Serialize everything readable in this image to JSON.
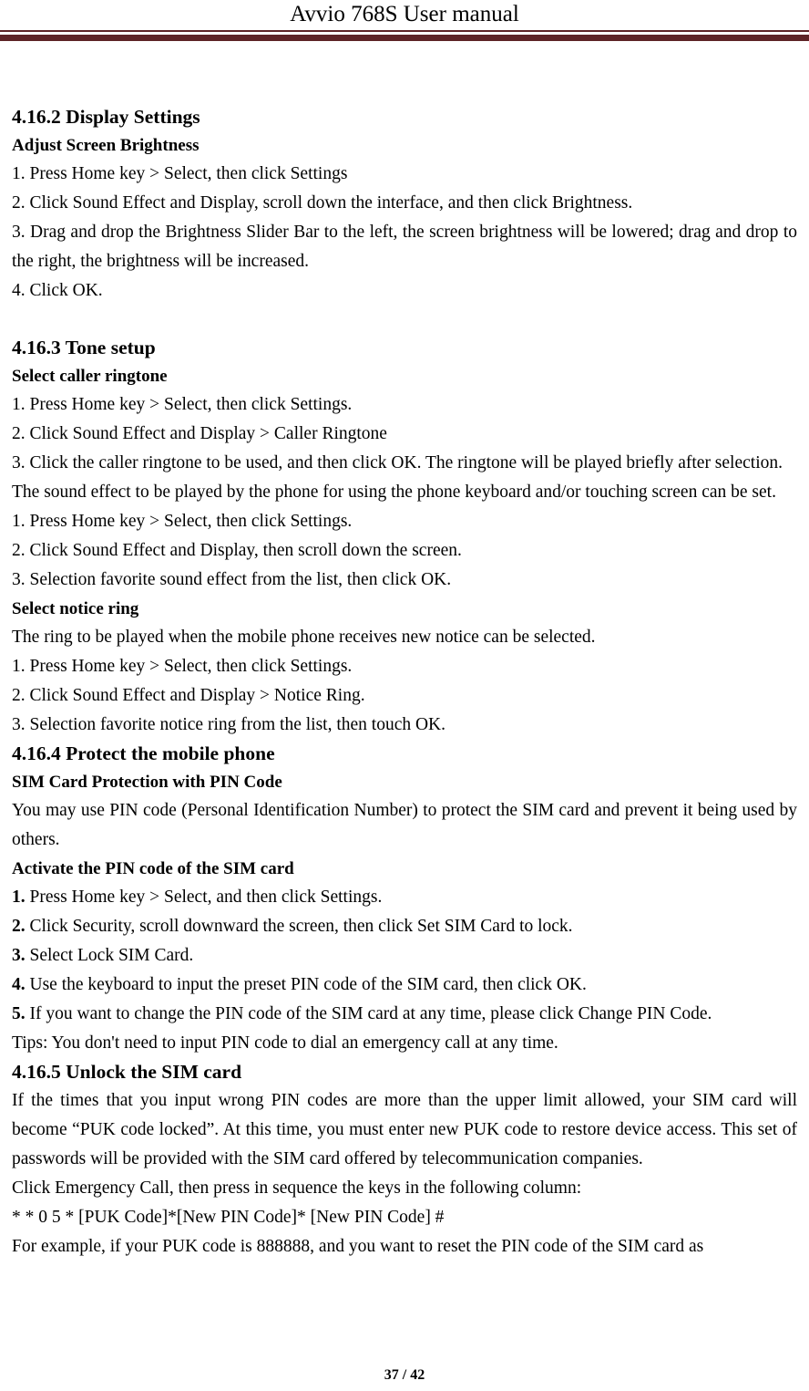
{
  "header": {
    "title": "Avvio 768S User manual",
    "rule_color": "#5E2427"
  },
  "footer": {
    "page_number": "37 / 42"
  },
  "document": {
    "sections": [
      {
        "heading": "4.16.2 Display Settings",
        "subheading": "Adjust Screen Brightness",
        "lines": [
          "1. Press Home key > Select, then click Settings",
          "2. Click Sound Effect and Display, scroll down the interface, and then click Brightness."
        ],
        "paragraph": "3. Drag and drop the Brightness Slider Bar to the left, the screen brightness will be lowered; drag and drop to the right, the brightness will be increased.",
        "closing": "4. Click OK."
      },
      {
        "heading": "4.16.3 Tone setup",
        "subheading": "Select caller ringtone",
        "lines": [
          "1. Press Home key > Select, then click Settings.",
          "2. Click Sound Effect and Display > Caller Ringtone"
        ],
        "paragraph_a": "3. Click the caller ringtone to be used, and then click OK. The ringtone will be played briefly after selection.",
        "paragraph_b": "The sound effect to be played by the phone for using the phone keyboard and/or touching screen can be set.",
        "lines_b": [
          "1. Press Home key > Select, then click Settings.",
          "2. Click Sound Effect and Display, then scroll down the screen.",
          "3. Selection favorite sound effect from the list, then click OK."
        ],
        "subheading_b": "Select notice ring",
        "lines_c": [
          "The ring to be played when the mobile phone receives new notice can be selected.",
          "1. Press Home key > Select, then click Settings.",
          "2. Click Sound Effect and Display > Notice Ring.",
          "3. Selection favorite notice ring from the list, then touch OK."
        ]
      },
      {
        "heading": "4.16.4 Protect the mobile phone",
        "subheading": "SIM Card Protection with PIN Code",
        "paragraph": "You may use PIN code (Personal Identification Number) to protect the SIM card and prevent it being used by others.",
        "subheading_b": "Activate the PIN code of the SIM card",
        "steps": [
          {
            "number": "1.",
            "text": " Press Home key > Select, and then click Settings."
          },
          {
            "number": "2.",
            "text": " Click Security, scroll downward the screen, then click Set SIM Card to lock."
          },
          {
            "number": "3.",
            "text": " Select Lock SIM Card."
          },
          {
            "number": "4.",
            "text": " Use the keyboard to input the preset PIN code of the SIM card, then click OK."
          },
          {
            "number": "5.",
            "text": " If you want to change the PIN code of the SIM card at any time, please click Change PIN Code."
          }
        ],
        "tips": "Tips: You don't need to input PIN code to dial an emergency call at any time."
      },
      {
        "heading": "4.16.5 Unlock the SIM card",
        "paragraph": "If the times that you input wrong PIN codes are more than the upper limit allowed, your SIM card will become “PUK code locked”. At this time, you must enter new PUK code to restore device access. This set of passwords will be provided with the SIM card offered by telecommunication companies.",
        "lines": [
          "Click Emergency Call, then press in sequence the keys in the following column:",
          "* * 0 5 * [PUK Code]*[New PIN Code]* [New PIN Code] #",
          "For example, if your PUK code is 888888, and you want to reset the PIN code of the SIM card as"
        ]
      }
    ]
  }
}
